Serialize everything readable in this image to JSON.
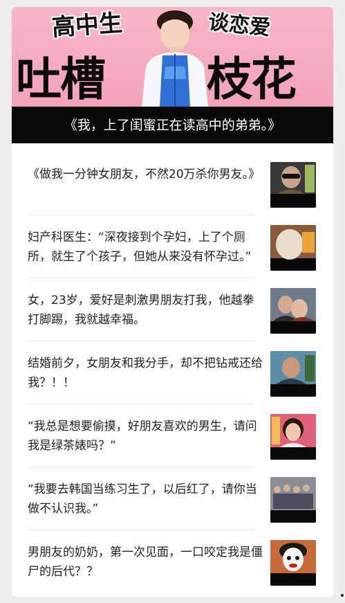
{
  "banner": {
    "tag_left": "高中生",
    "tag_right": "谈恋爱",
    "title_left": "吐槽",
    "title_right": "枝花",
    "caption": "《我，上了闺蜜正在读高中的弟弟。》"
  },
  "articles": [
    {
      "title": "《做我一分钟女朋友，不然20万杀你男友。》",
      "thumb_icon": "sunglasses-man-thumbnail"
    },
    {
      "title": "妇产科医生：“深夜接到个孕妇，上了个厕所，就生了个孩子，但她从来没有怀孕过。”",
      "thumb_icon": "pregnant-belly-thumbnail"
    },
    {
      "title": "女，23岁，爱好是刺激男朋友打我，他越拳打脚踢，我就越幸福。",
      "thumb_icon": "couple-hug-thumbnail"
    },
    {
      "title": "结婚前夕，女朋友和我分手，却不把钻戒还给我？！！",
      "thumb_icon": "man-portrait-thumbnail"
    },
    {
      "title": "“我总是想要偷摸，好朋友喜欢的男生，请问我是绿茶婊吗？”",
      "thumb_icon": "woman-smile-thumbnail"
    },
    {
      "title": "“我要去韩国当练习生了，以后红了，请你当做不认识我。”",
      "thumb_icon": "group-photo-thumbnail"
    },
    {
      "title": "男朋友的奶奶，第一次见面，一口咬定我是僵尸的后代？？",
      "thumb_icon": "clown-face-thumbnail"
    }
  ]
}
